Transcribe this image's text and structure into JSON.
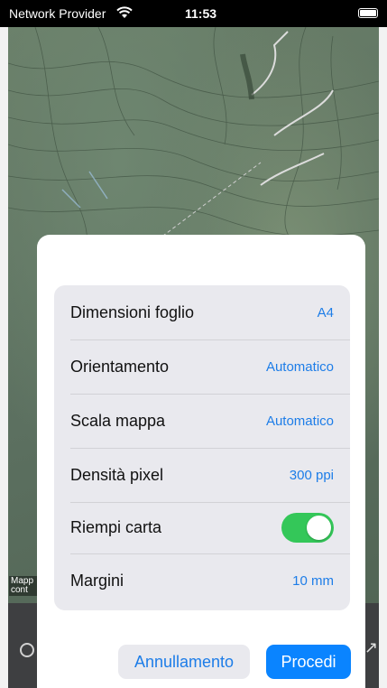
{
  "status_bar": {
    "carrier": "Network Provider",
    "time": "11:53"
  },
  "map": {
    "attribution_line1": "Mapp",
    "attribution_line2": "cont"
  },
  "print_settings": {
    "rows": [
      {
        "label": "Dimensioni foglio",
        "value": "A4"
      },
      {
        "label": "Orientamento",
        "value": "Automatico"
      },
      {
        "label": "Scala mappa",
        "value": "Automatico"
      },
      {
        "label": "Densità pixel",
        "value": "300 ppi"
      },
      {
        "label": "Riempi carta",
        "toggle_on": true
      },
      {
        "label": "Margini",
        "value": "10 mm"
      }
    ]
  },
  "actions": {
    "cancel_label": "Annullamento",
    "proceed_label": "Procedi"
  },
  "colors": {
    "accent": "#1d7de8",
    "primary_button": "#0a84ff",
    "toggle_on": "#34c759"
  }
}
